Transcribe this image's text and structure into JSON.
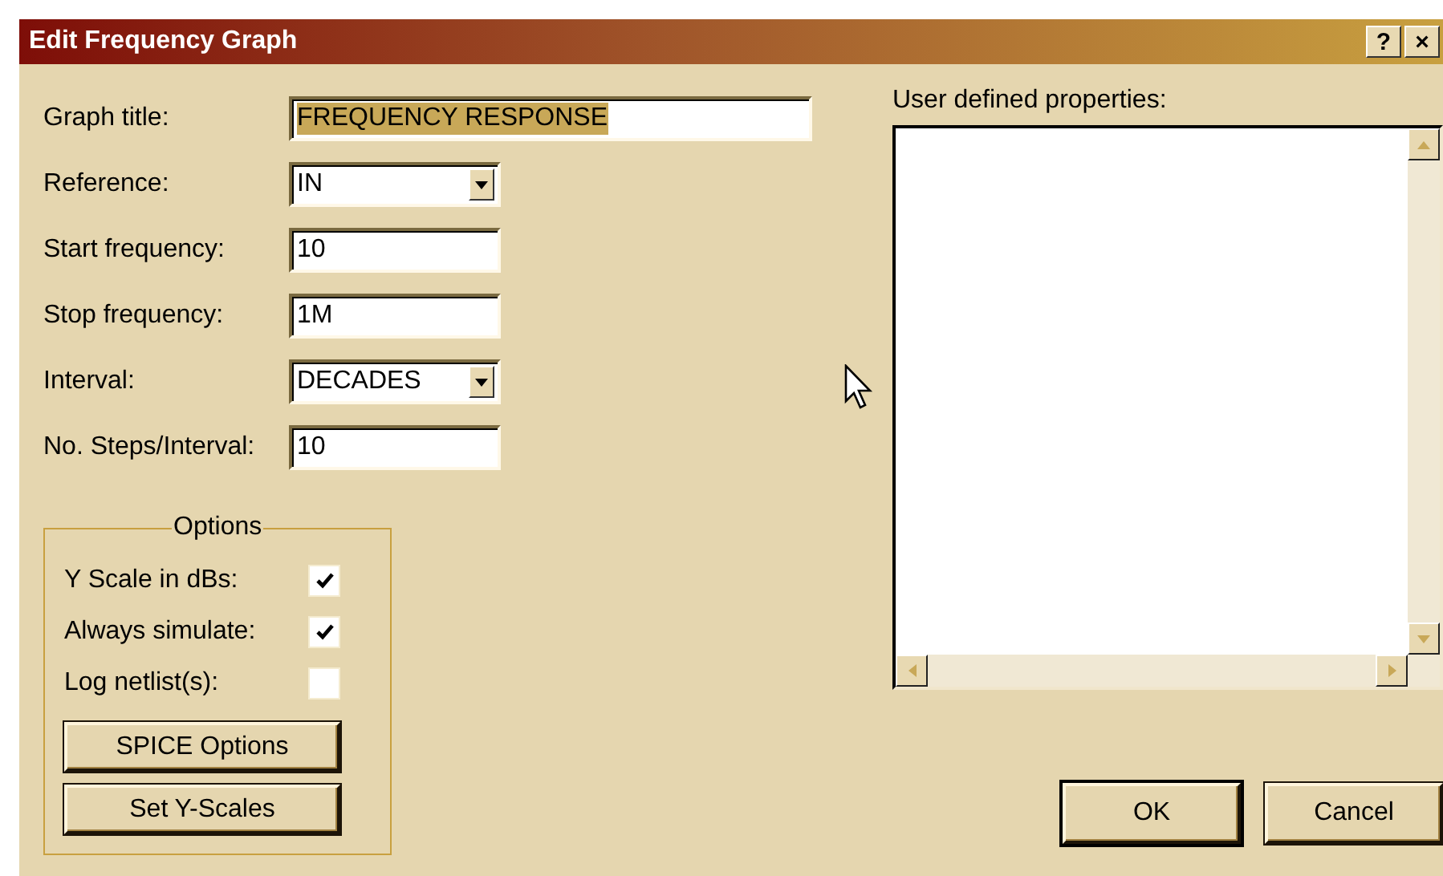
{
  "window": {
    "title": "Edit Frequency Graph",
    "help_button": "?",
    "close_button": "×"
  },
  "fields": [
    {
      "label": "Graph title:",
      "kind": "text",
      "value": "FREQUENCY RESPONSE",
      "text_selected": true,
      "wide": true
    },
    {
      "label": "Reference:",
      "kind": "dropdown",
      "value": "IN"
    },
    {
      "label": "Start frequency:",
      "kind": "text",
      "value": "10",
      "text_selected": false
    },
    {
      "label": "Stop frequency:",
      "kind": "text",
      "value": "1M",
      "text_selected": false
    },
    {
      "label": "Interval:",
      "kind": "dropdown",
      "value": "DECADES"
    },
    {
      "label": "No. Steps/Interval:",
      "kind": "text",
      "value": "10",
      "text_selected": false
    }
  ],
  "options": {
    "title": "Options",
    "checkboxes": [
      {
        "label": "Y Scale in dBs:",
        "checked": true
      },
      {
        "label": "Always simulate:",
        "checked": true
      },
      {
        "label": "Log netlist(s):",
        "checked": false
      }
    ],
    "buttons": [
      "SPICE Options",
      "Set Y-Scales"
    ]
  },
  "properties": {
    "label": "User defined properties:"
  },
  "buttons": [
    {
      "label": "OK",
      "default": true
    },
    {
      "label": "Cancel",
      "default": false
    }
  ]
}
